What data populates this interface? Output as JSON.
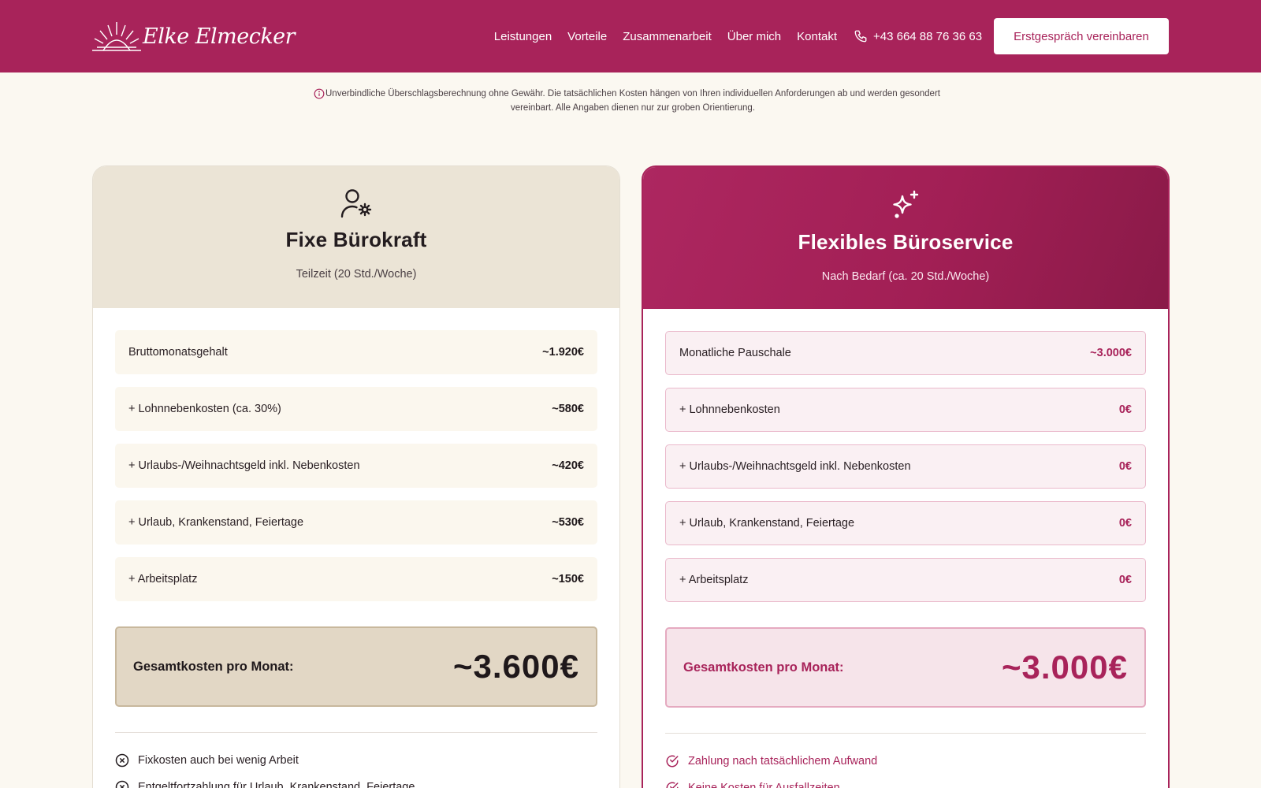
{
  "header": {
    "logo_text": "Elke Elmecker",
    "nav": [
      "Leistungen",
      "Vorteile",
      "Zusammenarbeit",
      "Über mich",
      "Kontakt"
    ],
    "phone": "+43 664 88 76 36 63",
    "cta": "Erstgespräch vereinbaren"
  },
  "disclaimer": "Unverbindliche Überschlagsberechnung ohne Gewähr. Die tatsächlichen Kosten hängen von Ihren individuellen Anforderungen ab und werden gesondert vereinbart. Alle Angaben dienen nur zur groben Orientierung.",
  "cards": {
    "fixed": {
      "icon": "user-gear-icon",
      "title": "Fixe Bürokraft",
      "subtitle": "Teilzeit (20 Std./Woche)",
      "rows": [
        {
          "label": "Bruttomonatsgehalt",
          "value": "~1.920€"
        },
        {
          "label": "+ Lohnnebenkosten (ca. 30%)",
          "value": "~580€"
        },
        {
          "label": "+ Urlaubs-/Weihnachtsgeld inkl. Nebenkosten",
          "value": "~420€"
        },
        {
          "label": "+ Urlaub, Krankenstand, Feiertage",
          "value": "~530€"
        },
        {
          "label": "+ Arbeitsplatz",
          "value": "~150€"
        }
      ],
      "total_label": "Gesamtkosten pro Monat:",
      "total_value": "~3.600€",
      "features": [
        "Fixkosten auch bei wenig Arbeit",
        "Entgeltfortzahlung für Urlaub, Krankenstand, Feiertage"
      ]
    },
    "flexible": {
      "icon": "sparkles-icon",
      "title": "Flexibles Büroservice",
      "subtitle": "Nach Bedarf (ca. 20 Std./Woche)",
      "rows": [
        {
          "label": "Monatliche Pauschale",
          "value": "~3.000€"
        },
        {
          "label": "+ Lohnnebenkosten",
          "value": "0€"
        },
        {
          "label": "+ Urlaubs-/Weihnachtsgeld inkl. Nebenkosten",
          "value": "0€"
        },
        {
          "label": "+ Urlaub, Krankenstand, Feiertage",
          "value": "0€"
        },
        {
          "label": "+ Arbeitsplatz",
          "value": "0€"
        }
      ],
      "total_label": "Gesamtkosten pro Monat:",
      "total_value": "~3.000€",
      "features": [
        "Zahlung nach tatsächlichem Aufwand",
        "Keine Kosten für Ausfallzeiten"
      ]
    }
  },
  "colors": {
    "brand": "#a8235a",
    "page_bg": "#fbf8f1",
    "card_beige": "#ebe4d6"
  }
}
